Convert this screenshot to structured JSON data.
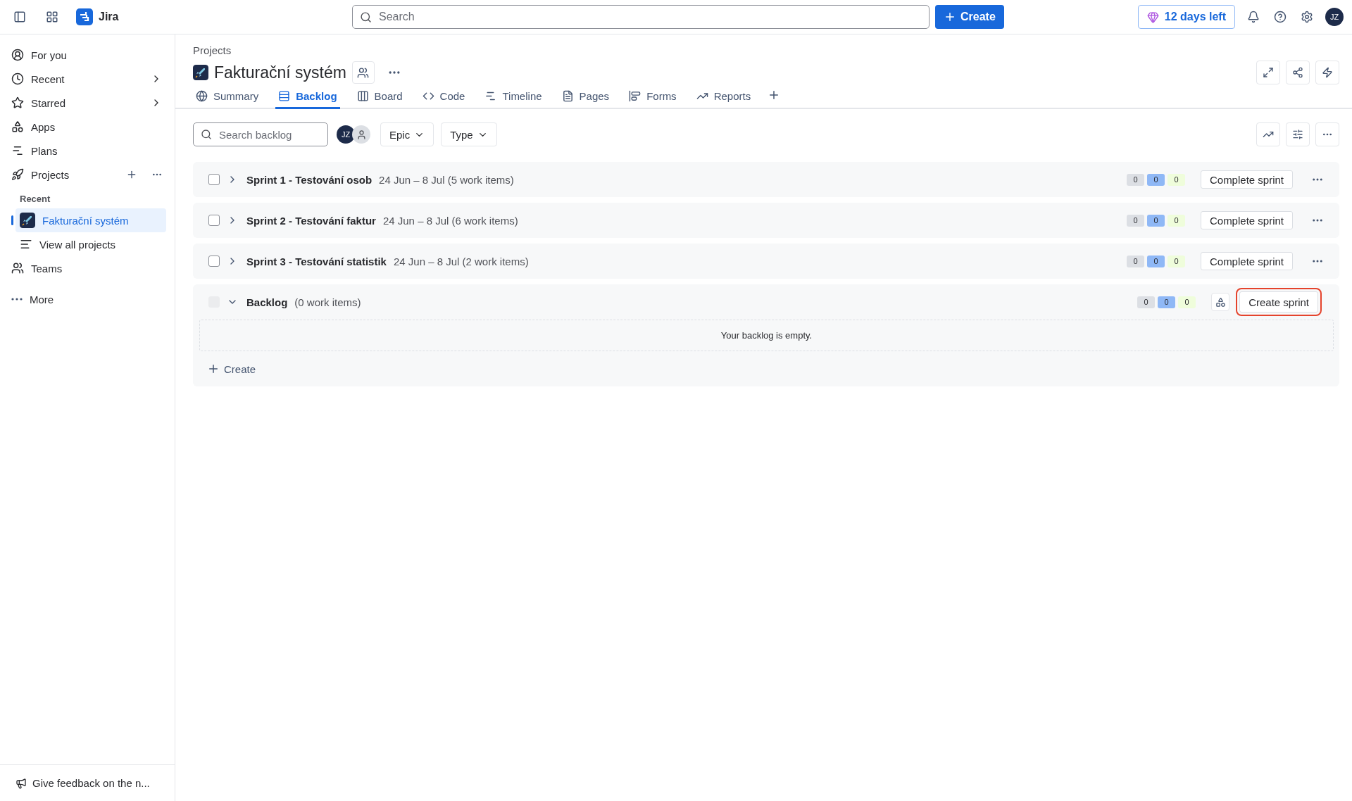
{
  "topbar": {
    "app_name": "Jira",
    "search": {
      "placeholder": "Search"
    },
    "create_button": "Create",
    "trial_button": "12 days left",
    "avatar": "JZ"
  },
  "sidebar": {
    "items": [
      {
        "kind": "nav",
        "label": "For you",
        "chevron": false,
        "selected": false
      },
      {
        "kind": "nav",
        "label": "Recent",
        "chevron": true,
        "selected": false
      },
      {
        "kind": "nav",
        "label": "Starred",
        "chevron": true,
        "selected": false
      },
      {
        "kind": "nav",
        "label": "Apps",
        "chevron": false,
        "selected": false
      },
      {
        "kind": "nav",
        "label": "Plans",
        "chevron": false,
        "selected": false
      },
      {
        "kind": "section",
        "label": "Projects",
        "selected": false
      },
      {
        "kind": "heading",
        "label": "Recent"
      },
      {
        "kind": "project",
        "label": "Fakturační systém",
        "selected": true
      },
      {
        "kind": "sub",
        "label": "View all projects",
        "selected": false
      },
      {
        "kind": "nav",
        "label": "Teams",
        "chevron": false,
        "selected": false
      },
      {
        "kind": "more",
        "label": "More",
        "selected": false
      }
    ],
    "feedback": "Give feedback on the n..."
  },
  "header": {
    "breadcrumb": "Projects",
    "title": "Fakturační systém",
    "tabs": [
      {
        "label": "Summary",
        "selected": false
      },
      {
        "label": "Backlog",
        "selected": true
      },
      {
        "label": "Board",
        "selected": false
      },
      {
        "label": "Code",
        "selected": false
      },
      {
        "label": "Timeline",
        "selected": false
      },
      {
        "label": "Pages",
        "selected": false
      },
      {
        "label": "Forms",
        "selected": false
      },
      {
        "label": "Reports",
        "selected": false
      }
    ]
  },
  "toolbar": {
    "search": {
      "placeholder": "Search backlog"
    },
    "avatars": [
      {
        "kind": "initials",
        "initials": "JZ"
      },
      {
        "kind": "person"
      }
    ],
    "filters": [
      "Epic",
      "Type"
    ]
  },
  "sprints": [
    {
      "name": "Sprint 1 - Testování osob",
      "info": "24 Jun – 8 Jul (5 work items)",
      "checked": false,
      "expanded": false,
      "counts": [
        {
          "value": "0",
          "color": "#dcdfe4"
        },
        {
          "value": "0",
          "color": "#8fb8f6"
        },
        {
          "value": "0",
          "color": "#effddb"
        }
      ],
      "action": "Complete sprint"
    },
    {
      "name": "Sprint 2 - Testování faktur",
      "info": "24 Jun – 8 Jul (6 work items)",
      "checked": false,
      "expanded": false,
      "counts": [
        {
          "value": "0",
          "color": "#dcdfe4"
        },
        {
          "value": "0",
          "color": "#8fb8f6"
        },
        {
          "value": "0",
          "color": "#effddb"
        }
      ],
      "action": "Complete sprint"
    },
    {
      "name": "Sprint 3 - Testování statistik",
      "info": "24 Jun – 8 Jul (2 work items)",
      "checked": false,
      "expanded": false,
      "counts": [
        {
          "value": "0",
          "color": "#dcdfe4"
        },
        {
          "value": "0",
          "color": "#8fb8f6"
        },
        {
          "value": "0",
          "color": "#effddb"
        }
      ],
      "action": "Complete sprint"
    }
  ],
  "backlog": {
    "name": "Backlog",
    "info": "(0 work items)",
    "disabled": true,
    "expanded": true,
    "counts": [
      {
        "value": "0",
        "color": "#dcdfe4"
      },
      {
        "value": "0",
        "color": "#8fb8f6"
      },
      {
        "value": "0",
        "color": "#effddb"
      }
    ],
    "action": "Create sprint",
    "highlighted": true,
    "empty_text": "Your backlog is empty.",
    "create": "Create"
  }
}
